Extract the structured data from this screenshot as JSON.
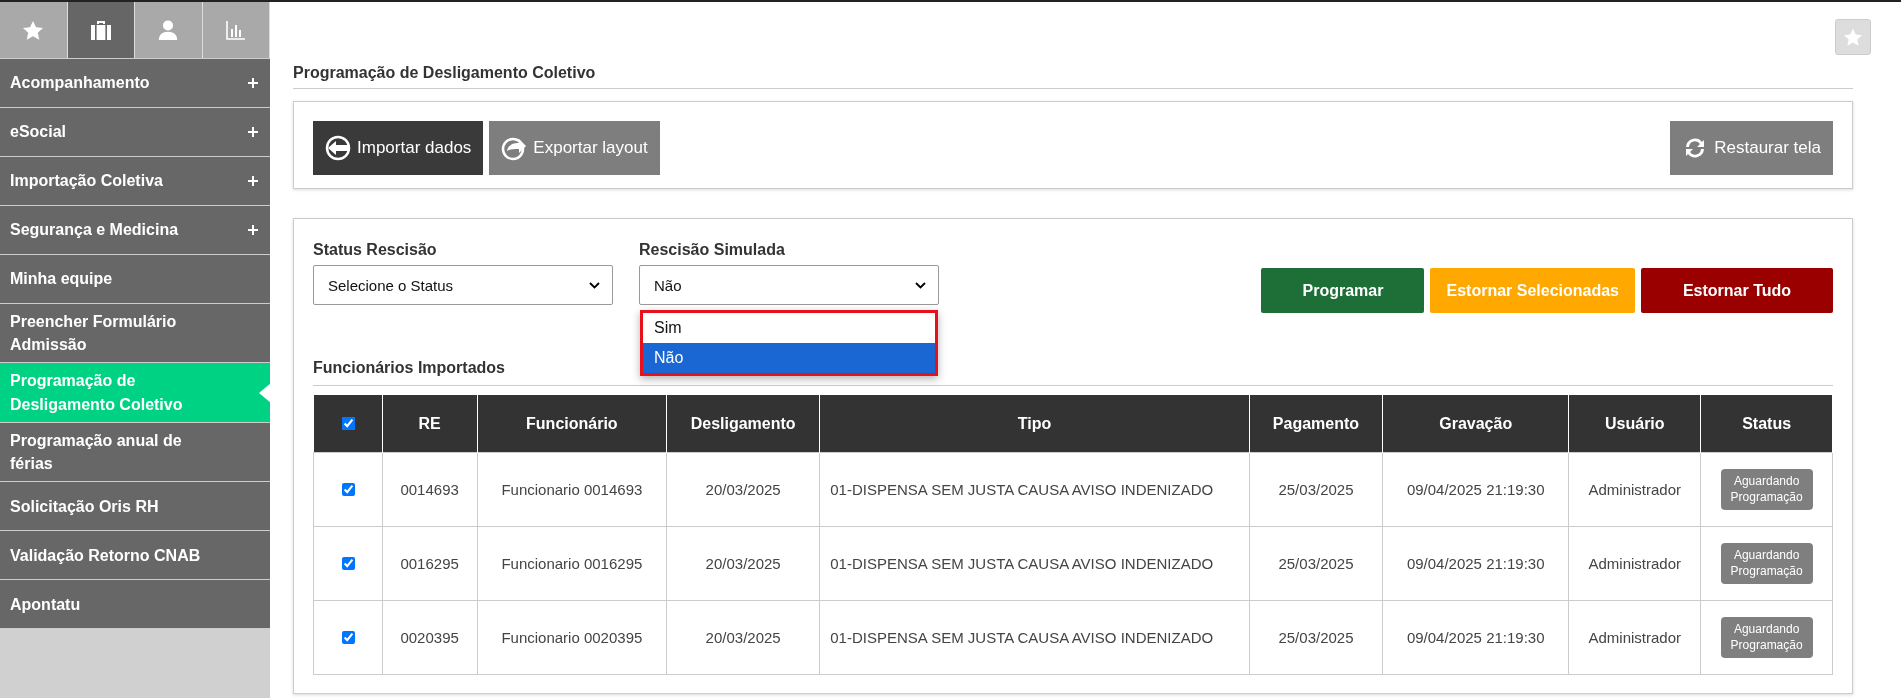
{
  "sidebar": {
    "tabs": [
      {
        "kind": "star",
        "selected": false
      },
      {
        "kind": "briefcase",
        "selected": true
      },
      {
        "kind": "person",
        "selected": false
      },
      {
        "kind": "chart",
        "selected": false
      }
    ],
    "items": [
      {
        "label": "Acompanhamento",
        "expandable": true,
        "selected": false
      },
      {
        "label": "eSocial",
        "expandable": true,
        "selected": false
      },
      {
        "label": "Importação Coletiva",
        "expandable": true,
        "selected": false
      },
      {
        "label": "Segurança e Medicina",
        "expandable": true,
        "selected": false
      },
      {
        "label": "Minha equipe",
        "expandable": false,
        "selected": false
      },
      {
        "label": "Preencher Formulário Admissão",
        "expandable": false,
        "selected": false
      },
      {
        "label": "Programação de Desligamento Coletivo",
        "expandable": false,
        "selected": true
      },
      {
        "label": "Programação anual de férias",
        "expandable": false,
        "selected": false
      },
      {
        "label": "Solicitação Oris RH",
        "expandable": false,
        "selected": false
      },
      {
        "label": "Validação Retorno CNAB",
        "expandable": false,
        "selected": false
      },
      {
        "label": "Apontatu",
        "expandable": false,
        "selected": false
      }
    ]
  },
  "page_title": "Programação de Desligamento Coletivo",
  "toolbar": {
    "left": [
      {
        "label": "Importar dados",
        "kind": "import"
      },
      {
        "label": "Exportar layout",
        "kind": "export"
      }
    ],
    "right": [
      {
        "label": "Restaurar tela",
        "kind": "refresh"
      }
    ]
  },
  "filters": [
    {
      "label": "Status Rescisão",
      "value": "Selecione o Status"
    },
    {
      "label": "Rescisão Simulada",
      "value": "Não",
      "options": [
        {
          "label": "Sim",
          "selected": false
        },
        {
          "label": "Não",
          "selected": true
        }
      ]
    }
  ],
  "actions": [
    {
      "label": "Programar",
      "kind": "green"
    },
    {
      "label": "Estornar Selecionadas",
      "kind": "orange"
    },
    {
      "label": "Estornar Tudo",
      "kind": "red"
    }
  ],
  "section_title": "Funcionários Importados",
  "table": {
    "all_checked": true,
    "columns": [
      "RE",
      "Funcionário",
      "Desligamento",
      "Tipo",
      "Pagamento",
      "Gravação",
      "Usuário",
      "Status"
    ],
    "rows": [
      {
        "checked": true,
        "cells": [
          "0014693",
          "Funcionario 0014693",
          "20/03/2025",
          "01-DISPENSA SEM JUSTA CAUSA AVISO INDENIZADO",
          "25/03/2025",
          "09/04/2025 21:19:30",
          "Administrador"
        ],
        "status": "Aguardando Programação"
      },
      {
        "checked": true,
        "cells": [
          "0016295",
          "Funcionario 0016295",
          "20/03/2025",
          "01-DISPENSA SEM JUSTA CAUSA AVISO INDENIZADO",
          "25/03/2025",
          "09/04/2025 21:19:30",
          "Administrador"
        ],
        "status": "Aguardando Programação"
      },
      {
        "checked": true,
        "cells": [
          "0020395",
          "Funcionario 0020395",
          "20/03/2025",
          "01-DISPENSA SEM JUSTA CAUSA AVISO INDENIZADO",
          "25/03/2025",
          "09/04/2025 21:19:30",
          "Administrador"
        ],
        "status": "Aguardando Programação"
      }
    ]
  }
}
